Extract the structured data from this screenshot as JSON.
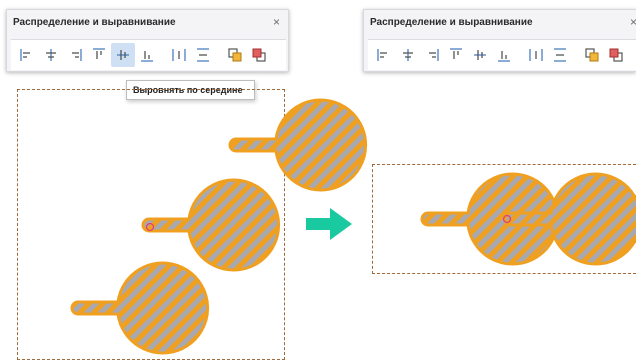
{
  "left_panel": {
    "title": "Распределение и выравнивание",
    "close": "×"
  },
  "right_panel": {
    "title": "Распределение и выравнивание",
    "close": "×"
  },
  "toolbar": {
    "buttons": [
      {
        "icon": "align-left-icon"
      },
      {
        "icon": "align-center-icon"
      },
      {
        "icon": "align-right-icon"
      },
      {
        "icon": "align-top-icon"
      },
      {
        "icon": "align-middle-icon",
        "active_in_left": true
      },
      {
        "icon": "align-bottom-icon"
      },
      {
        "icon": "distribute-horizontal-icon"
      },
      {
        "icon": "distribute-vertical-icon"
      },
      {
        "icon": "send-backward-icon"
      },
      {
        "icon": "bring-forward-icon"
      }
    ]
  },
  "tooltip": {
    "text": "Выровнять по середине"
  },
  "colors": {
    "shape_fill": "#f0a020",
    "stripe": "#a8a8b0",
    "selection": "#a06a3c",
    "arrow": "#19c9a0",
    "active_button": "#cfe0f5",
    "marker": "#e0407a"
  }
}
